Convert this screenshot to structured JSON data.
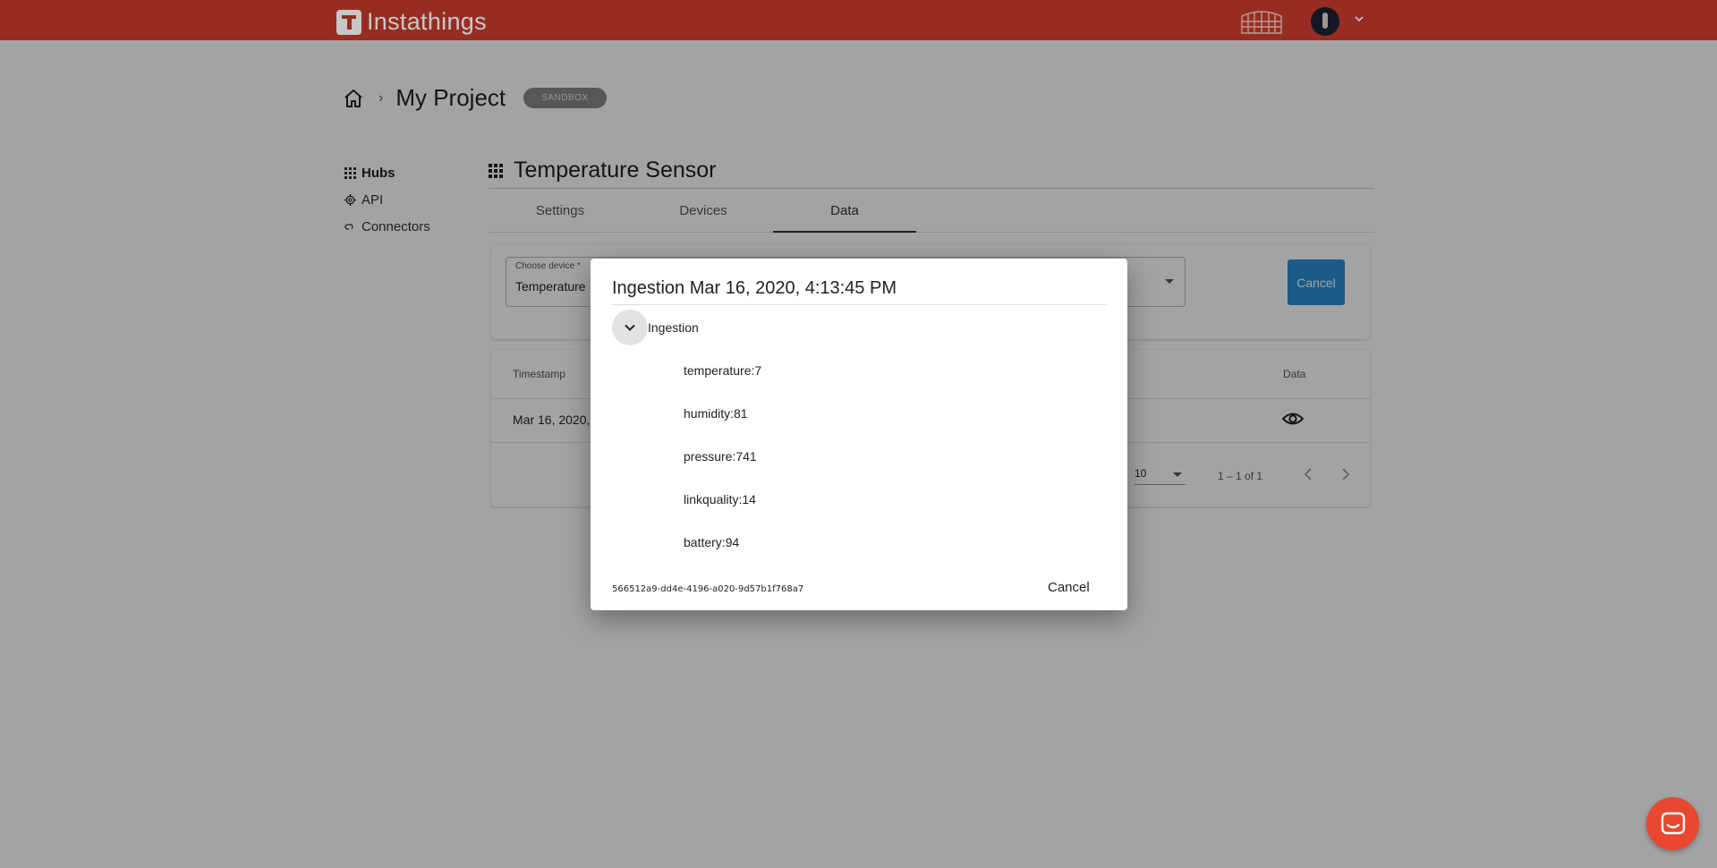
{
  "app": {
    "brand_name": "Instathings",
    "brand_color": "#c23a2c"
  },
  "breadcrumb": {
    "home_icon": "home-icon",
    "separator": "›",
    "project_name": "My Project",
    "badge": "SANDBOX"
  },
  "sidebar": {
    "items": [
      {
        "label": "Hubs",
        "icon": "grid-icon",
        "active": true
      },
      {
        "label": "API",
        "icon": "gear-icon",
        "active": false
      },
      {
        "label": "Connectors",
        "icon": "link-icon",
        "active": false
      }
    ]
  },
  "hub": {
    "title": "Temperature Sensor",
    "tabs": [
      {
        "label": "Settings",
        "active": false
      },
      {
        "label": "Devices",
        "active": false
      },
      {
        "label": "Data",
        "active": true
      }
    ]
  },
  "device_select": {
    "label": "Choose device *",
    "value": "Temperature",
    "cancel_label": "Cancel"
  },
  "table": {
    "headers": {
      "timestamp": "Timestamp",
      "data": "Data"
    },
    "rows": [
      {
        "timestamp": "Mar 16, 2020,"
      }
    ],
    "pagination": {
      "rows_per_page": "10",
      "range": "1 – 1 of 1"
    }
  },
  "dialog": {
    "title": "Ingestion Mar 16, 2020, 4:13:45 PM",
    "group_label": "Ingestion",
    "entries": [
      "temperature:7",
      "humidity:81",
      "pressure:741",
      "linkquality:14",
      "battery:94"
    ],
    "id": "566512a9-dd4e-4196-a020-9d57b1f768a7",
    "cancel_label": "Cancel"
  },
  "colors": {
    "accent_blue": "#2b8fd4",
    "chat_button": "#e8482f"
  }
}
